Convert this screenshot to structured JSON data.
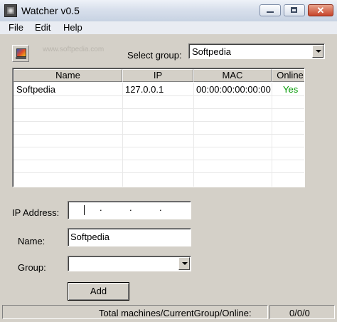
{
  "window": {
    "title": "Watcher v0.5",
    "controls": {
      "close_label": "✕"
    }
  },
  "menu": {
    "items": [
      "File",
      "Edit",
      "Help"
    ]
  },
  "watermark": "www.softpedia.com",
  "group_select": {
    "label": "Select group:",
    "value": "Softpedia"
  },
  "machines_table": {
    "columns": [
      "Name",
      "IP",
      "MAC",
      "Online"
    ],
    "rows": [
      {
        "name": "Softpedia",
        "ip": "127.0.0.1",
        "mac": "00:00:00:00:00:00",
        "online": "Yes"
      }
    ],
    "online_color": "#009900"
  },
  "form": {
    "ip_label": "IP Address:",
    "ip_dots": ".",
    "name_label": "Name:",
    "name_value": "Softpedia",
    "group_label": "Group:",
    "group_value": "",
    "add_button": "Add"
  },
  "status": {
    "summary_label": "Total machines/CurrentGroup/Online:",
    "summary_value": "0/0/0"
  },
  "colors": {
    "titlebar": "#d8e0ec",
    "dialog": "#d4d0c8",
    "close": "#c7452b"
  }
}
